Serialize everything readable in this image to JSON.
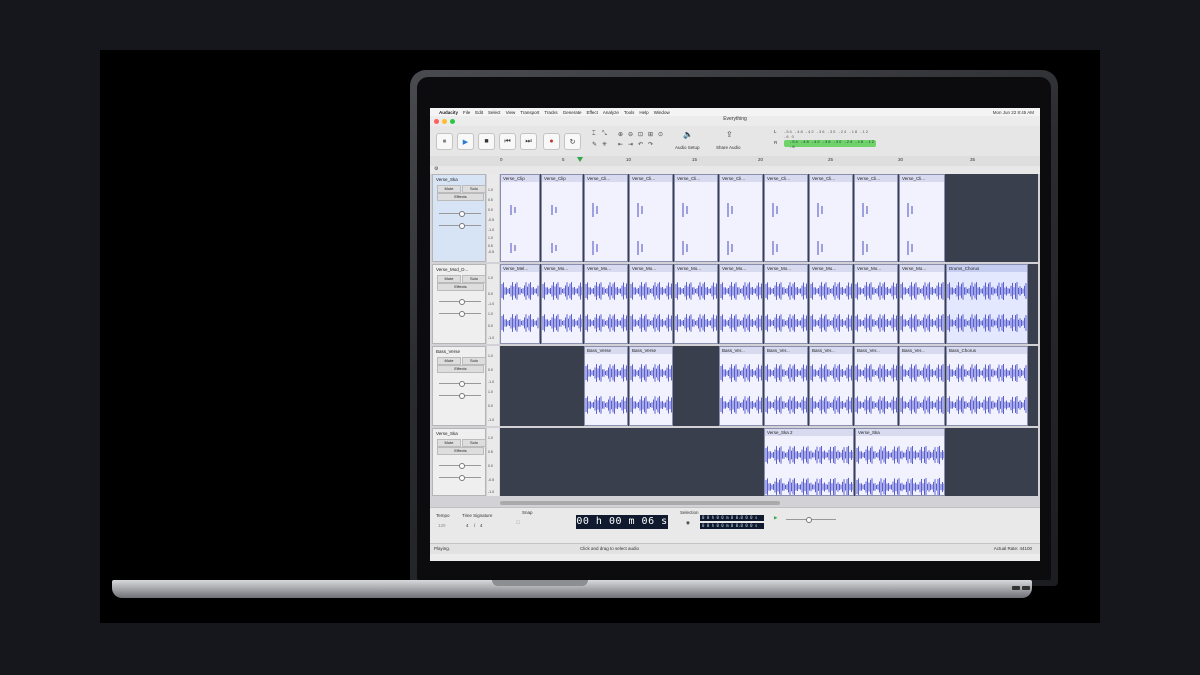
{
  "app": {
    "apple_glyph": "",
    "menu": [
      "Audacity",
      "File",
      "Edit",
      "Select",
      "View",
      "Transport",
      "Tracks",
      "Generate",
      "Effect",
      "Analyze",
      "Tools",
      "Help",
      "Window"
    ],
    "menubar_right": "Mon Jun 22  8:45 AM",
    "window_title": "Everything"
  },
  "toolbar": {
    "pause": "⏸",
    "play": "▶",
    "stop": "■",
    "skip_start": "⏮",
    "skip_end": "⏭",
    "record": "●",
    "loop": "↻",
    "audio_setup": "Audio Setup",
    "share_audio": "Share Audio",
    "meter_labels": "-54 -48 -42 -36 -30 -24 -18 -12 -6 0",
    "meter_levels": "-54 -48 -42 -36 -30 -24 -18 -12 -6",
    "meter_L": "L",
    "meter_R": "R"
  },
  "ruler": {
    "ticks": [
      "0",
      "5",
      "10",
      "15",
      "20",
      "25",
      "30",
      "35"
    ]
  },
  "tracks": [
    {
      "name": "Verse_Ska",
      "mute": "Mute",
      "solo": "Solo",
      "effects": "Effects",
      "scale": [
        "1.0",
        "0.5",
        "0.0",
        "-0.5",
        "-1.0",
        "1.0",
        "0.5",
        "0.0",
        "-0.5",
        "-1.0"
      ],
      "clips": [
        "Verse_Clip",
        "Verse_Clip",
        "Verse_Cli...",
        "Verse_Cli...",
        "Verse_Cli...",
        "Verse_Cli...",
        "Verse_Cli...",
        "Verse_Cli...",
        "Verse_Cli...",
        "Verse_Cli..."
      ]
    },
    {
      "name": "Verse_Mod_D...",
      "mute": "Mute",
      "solo": "Solo",
      "effects": "Effects",
      "scale": [
        "1.0",
        "0.5",
        "0.0",
        "-0.5",
        "-1.0",
        "1.0",
        "0.5",
        "0.0",
        "-0.5",
        "-1.0"
      ],
      "clips": [
        "Verse_Mel...",
        "Verse_Mo...",
        "Verse_Mo...",
        "Verse_Mo...",
        "Verse_Mo...",
        "Verse_Mo...",
        "Verse_Mo...",
        "Verse_Mo...",
        "Verse_Mo...",
        "Verse_Mo...",
        "Drums_Chorus"
      ]
    },
    {
      "name": "Bass_Verse",
      "mute": "Mute",
      "solo": "Solo",
      "effects": "Effects",
      "scale": [
        "1.0",
        "0.5",
        "0.0",
        "-0.5",
        "-1.0",
        "1.0",
        "0.5",
        "0.0",
        "-0.5",
        "-1.0"
      ],
      "clips": [
        "Bass_Verse",
        "Bass_Verse",
        "Bass_Ver...",
        "Bass_Ver...",
        "Bass_Ver...",
        "Bass_Ver...",
        "Bass_Ver...",
        "Bass_Chorus"
      ]
    },
    {
      "name": "Verse_Ska",
      "mute": "Mute",
      "solo": "Solo",
      "effects": "Effects",
      "scale": [
        "1.0",
        "0.5",
        "0.0",
        "-0.5",
        "-1.0"
      ],
      "clips": [
        "Verse_Ska 2",
        "Verse_Ska"
      ]
    }
  ],
  "bottom": {
    "tempo_label": "Tempo",
    "tempo_value": "120",
    "time_sig_label": "Time Signature",
    "time_sig_num": "4",
    "time_sig_den": "4",
    "snap_label": "Snap",
    "time": "00 h 00 m 06 s",
    "selection_label": "Selection",
    "selection_start": "0 0 h 0 0 m 0 0.0 0 0 s",
    "selection_end": "0 0 h 0 0 m 0 0.0 0 0 s"
  },
  "status": {
    "left": "Playing.",
    "middle": "Click and drag to select audio",
    "right": "Actual Rate: 44100"
  }
}
